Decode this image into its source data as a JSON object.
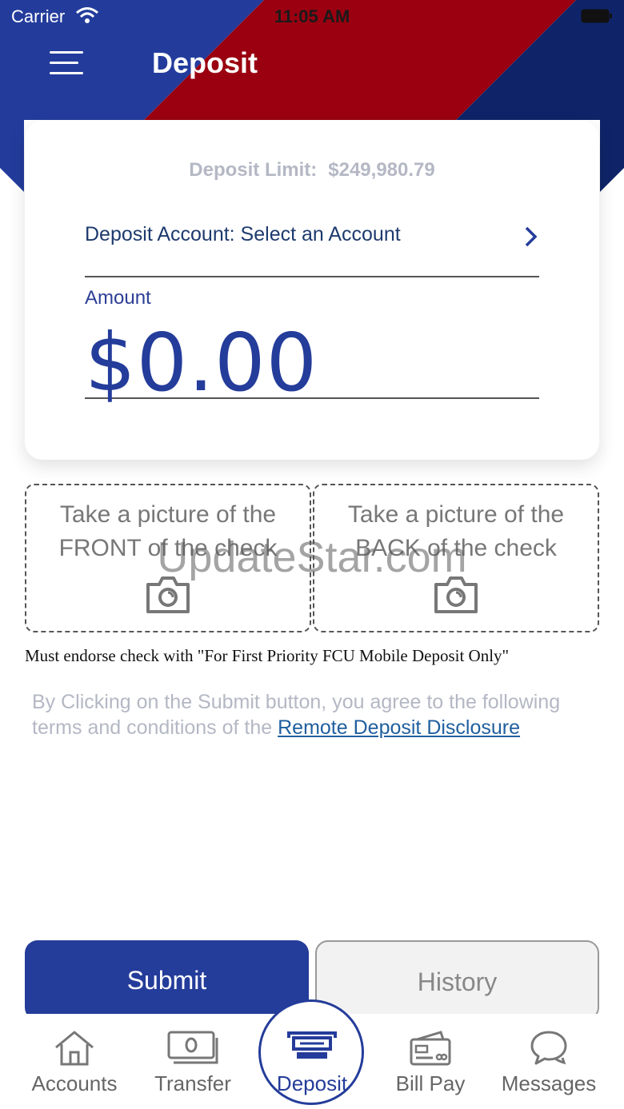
{
  "status_bar": {
    "carrier": "Carrier",
    "time": "11:05 AM"
  },
  "header": {
    "title": "Deposit"
  },
  "card": {
    "deposit_limit_label": "Deposit Limit:",
    "deposit_limit_value": "$249,980.79",
    "account_label": "Deposit Account: Select an Account",
    "amount_label": "Amount",
    "amount_value": "$0.00"
  },
  "capture": {
    "front_line1": "Take a picture of the",
    "front_line2": "FRONT of the check",
    "back_line1": "Take a picture of the",
    "back_line2": "BACK of the check"
  },
  "watermark": "UpdateStar.com",
  "endorse_note": "Must endorse check with \"For First Priority FCU Mobile Deposit Only\"",
  "terms": {
    "text": "By Clicking on the Submit button, you agree to the following terms and conditions of the ",
    "link": "Remote Deposit Disclosure"
  },
  "buttons": {
    "submit": "Submit",
    "history": "History"
  },
  "tabs": [
    {
      "label": "Accounts",
      "icon": "home-icon"
    },
    {
      "label": "Transfer",
      "icon": "money-icon"
    },
    {
      "label": "Deposit",
      "icon": "atm-icon"
    },
    {
      "label": "Bill Pay",
      "icon": "card-icon"
    },
    {
      "label": "Messages",
      "icon": "chat-icon"
    }
  ],
  "colors": {
    "brand_blue": "#243c9a",
    "brand_red": "#9a0010",
    "navy": "#0f2468"
  }
}
